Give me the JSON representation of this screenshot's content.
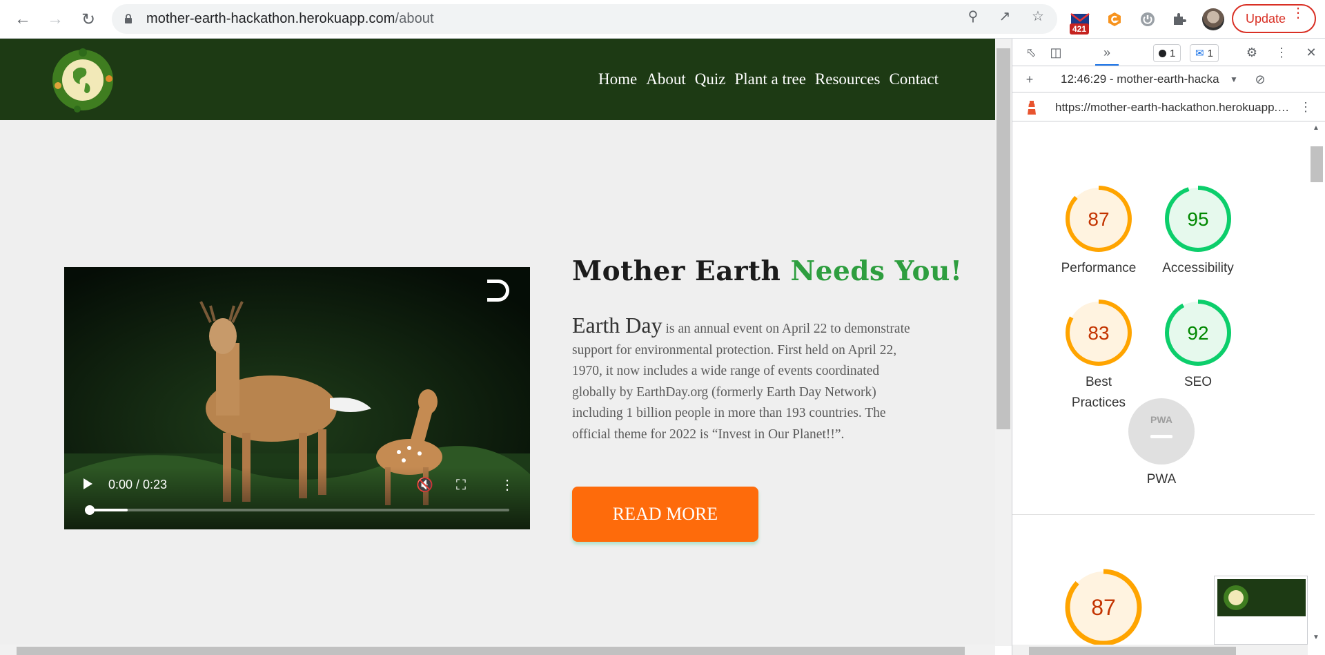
{
  "browser": {
    "url_host": "mother-earth-hackathon.herokuapp.com",
    "url_path": "/about",
    "mail_badge": "421",
    "update_label": "Update"
  },
  "site": {
    "nav": [
      "Home",
      "About",
      "Quiz",
      "Plant a tree",
      "Resources",
      "Contact"
    ],
    "headline_part1": "Mother Earth ",
    "headline_part2": "Needs You!",
    "lead": "Earth Day",
    "body": " is an annual event on April 22 to demonstrate support for environmental protection. First held on April 22, 1970, it now includes a wide range of events coordinated globally by EarthDay.org (formerly Earth Day Network) including 1 billion people in more than 193 countries. The official theme for 2022 is “Invest in Our Planet!!”.",
    "read_more": "READ MORE",
    "video": {
      "time": "0:00 / 0:23",
      "progress": 0.1
    }
  },
  "devtools": {
    "errors_count": "1",
    "messages_count": "1",
    "report_label": "12:46:29 - mother-earth-hacka",
    "lighthouse_url": "https://mother-earth-hackathon.herokuapp.com/about",
    "scores": [
      {
        "label": "Performance",
        "value": 87,
        "color": "#ffa400",
        "text_color": "#c33300",
        "bg": "#fff3e0"
      },
      {
        "label": "Accessibility",
        "value": 95,
        "color": "#0cce6b",
        "text_color": "#008800",
        "bg": "#e6f9ed"
      },
      {
        "label": "Best Practices",
        "value": 83,
        "color": "#ffa400",
        "text_color": "#c33300",
        "bg": "#fff3e0"
      },
      {
        "label": "SEO",
        "value": 92,
        "color": "#0cce6b",
        "text_color": "#008800",
        "bg": "#e6f9ed"
      }
    ],
    "pwa_label": "PWA",
    "pwa_badge": "PWA",
    "lower_score": 87
  }
}
